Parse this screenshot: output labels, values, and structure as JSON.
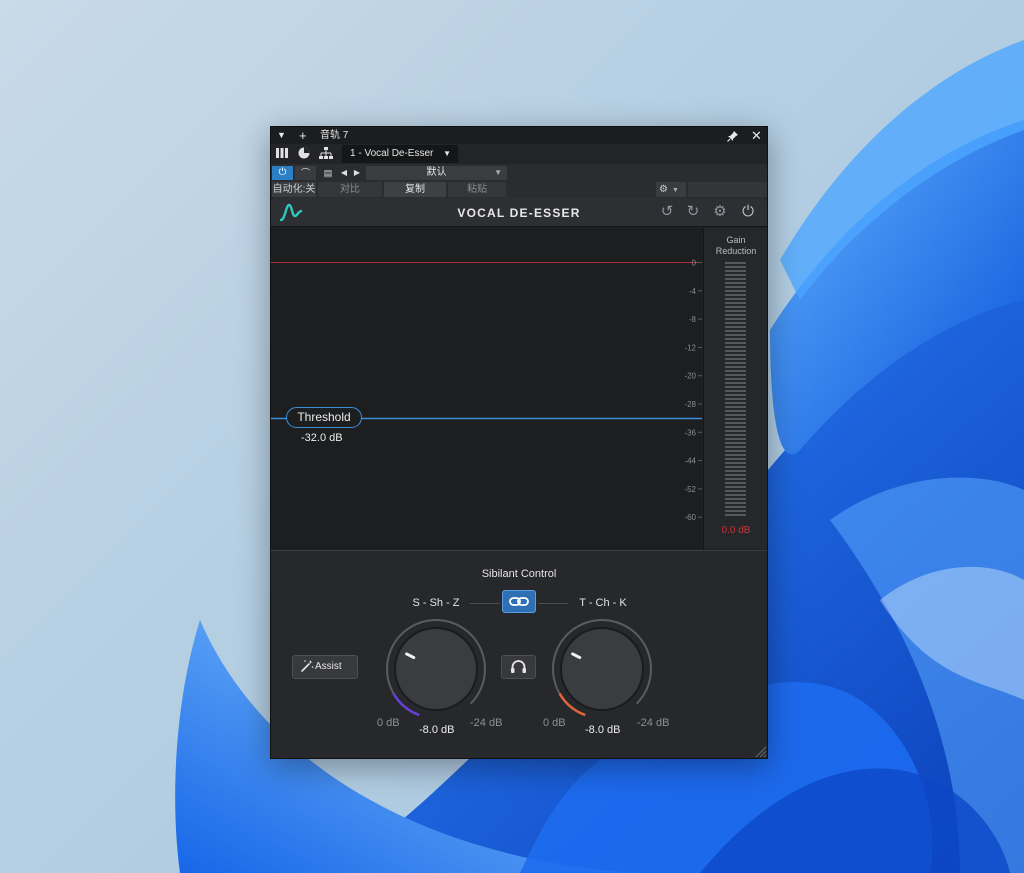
{
  "window": {
    "title": "音轨 7",
    "plugin_slot": "1 - Vocal De-Esser",
    "preset_name": "默认",
    "toolbar": {
      "automation_label": "自动化:关",
      "compare_label": "对比",
      "copy_label": "复制",
      "paste_label": "粘贴"
    }
  },
  "plugin": {
    "title": "VOCAL DE-ESSER",
    "graph": {
      "scale_labels": [
        "0",
        "-4",
        "-8",
        "-12",
        "-20",
        "-28",
        "-36",
        "-44",
        "-52",
        "-60"
      ],
      "threshold_label": "Threshold",
      "threshold_value": "-32.0 dB"
    },
    "meter": {
      "label_line1": "Gain",
      "label_line2": "Reduction",
      "value": "0.0 dB",
      "level": 0
    },
    "controls": {
      "title": "Sibilant Control",
      "assist_label": "Assist",
      "left": {
        "label": "S - Sh - Z",
        "min": "0 dB",
        "max": "-24 dB",
        "value": "-8.0 dB",
        "fraction": 0.333
      },
      "right": {
        "label": "T - Ch - K",
        "min": "0 dB",
        "max": "-24 dB",
        "value": "-8.0 dB",
        "fraction": 0.333
      }
    }
  },
  "colors": {
    "accent_blue": "#2b7fc4",
    "threshold_line": "#3b8ed6",
    "zero_line": "#a8333b",
    "meter_red": "#c9343c",
    "knob_left_arc": "#6a3fd6",
    "knob_right_arc": "#e0653a"
  }
}
